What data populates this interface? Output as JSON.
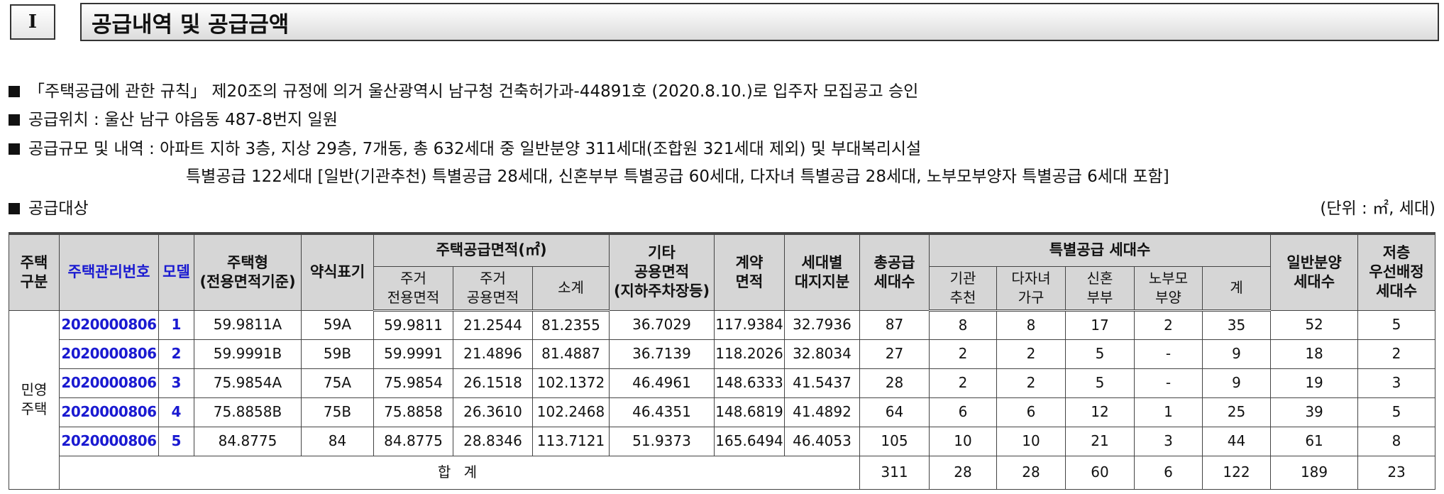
{
  "section": {
    "num": "I",
    "title": "공급내역 및 공급금액"
  },
  "bullets": {
    "b1": "「주택공급에 관한 규칙」 제20조의 규정에 의거 울산광역시 남구청 건축허가과-44891호 (2020.8.10.)로 입주자 모집공고 승인",
    "b2": "공급위치 : 울산 남구 야음동 487-8번지 일원",
    "b3a": "공급규모 및 내역 : 아파트 지하 3층, 지상 29층, 7개동, 총 632세대 중 일반분양 311세대(조합원 321세대 제외) 및 부대복리시설",
    "b3b": "특별공급 122세대 [일반(기관추천) 특별공급 28세대, 신혼부부 특별공급 60세대, 다자녀 특별공급 28세대, 노부모부양자 특별공급 6세대 포함]",
    "b4": "공급대상"
  },
  "unit": "(단위 : ㎡, 세대)",
  "headers": {
    "type1": "주택",
    "type2": "구분",
    "mgmt": "주택관리번호",
    "model": "모델",
    "htype1": "주택형",
    "htype2": "(전용면적기준)",
    "abbr": "약식표기",
    "area_group": "주택공급면적(㎡)",
    "excl1": "주거",
    "excl2": "전용면적",
    "comm1": "주거",
    "comm2": "공용면적",
    "subtotal": "소계",
    "other1": "기타",
    "other2": "공용면적",
    "other3": "(지하주차장등)",
    "contract1": "계약",
    "contract2": "면적",
    "land1": "세대별",
    "land2": "대지지분",
    "total1": "총공급",
    "total2": "세대수",
    "special_group": "특별공급 세대수",
    "inst1": "기관",
    "inst2": "추천",
    "multi1": "다자녀",
    "multi2": "가구",
    "newly1": "신혼",
    "newly2": "부부",
    "elder1": "노부모",
    "elder2": "부양",
    "sp_sum": "계",
    "general1": "일반분양",
    "general2": "세대수",
    "low1": "저층",
    "low2": "우선배정",
    "low3": "세대수"
  },
  "group_label": {
    "l1": "민영",
    "l2": "주택"
  },
  "rows": [
    {
      "id": "2020000806",
      "model": "1",
      "type": "59.9811A",
      "abbr": "59A",
      "excl": "59.9811",
      "comm": "21.2544",
      "sub": "81.2355",
      "other": "36.7029",
      "contract": "117.9384",
      "land": "32.7936",
      "total": "87",
      "inst": "8",
      "multi": "8",
      "newly": "17",
      "elder": "2",
      "sp": "35",
      "general": "52",
      "low": "5"
    },
    {
      "id": "2020000806",
      "model": "2",
      "type": "59.9991B",
      "abbr": "59B",
      "excl": "59.9991",
      "comm": "21.4896",
      "sub": "81.4887",
      "other": "36.7139",
      "contract": "118.2026",
      "land": "32.8034",
      "total": "27",
      "inst": "2",
      "multi": "2",
      "newly": "5",
      "elder": "-",
      "sp": "9",
      "general": "18",
      "low": "2"
    },
    {
      "id": "2020000806",
      "model": "3",
      "type": "75.9854A",
      "abbr": "75A",
      "excl": "75.9854",
      "comm": "26.1518",
      "sub": "102.1372",
      "other": "46.4961",
      "contract": "148.6333",
      "land": "41.5437",
      "total": "28",
      "inst": "2",
      "multi": "2",
      "newly": "5",
      "elder": "-",
      "sp": "9",
      "general": "19",
      "low": "3"
    },
    {
      "id": "2020000806",
      "model": "4",
      "type": "75.8858B",
      "abbr": "75B",
      "excl": "75.8858",
      "comm": "26.3610",
      "sub": "102.2468",
      "other": "46.4351",
      "contract": "148.6819",
      "land": "41.4892",
      "total": "64",
      "inst": "6",
      "multi": "6",
      "newly": "12",
      "elder": "1",
      "sp": "25",
      "general": "39",
      "low": "5"
    },
    {
      "id": "2020000806",
      "model": "5",
      "type": "84.8775",
      "abbr": "84",
      "excl": "84.8775",
      "comm": "28.8346",
      "sub": "113.7121",
      "other": "51.9373",
      "contract": "165.6494",
      "land": "46.4053",
      "total": "105",
      "inst": "10",
      "multi": "10",
      "newly": "21",
      "elder": "3",
      "sp": "44",
      "general": "61",
      "low": "8"
    }
  ],
  "totals": {
    "label": "합 계",
    "total": "311",
    "inst": "28",
    "multi": "28",
    "newly": "60",
    "elder": "6",
    "sp": "122",
    "general": "189",
    "low": "23"
  }
}
